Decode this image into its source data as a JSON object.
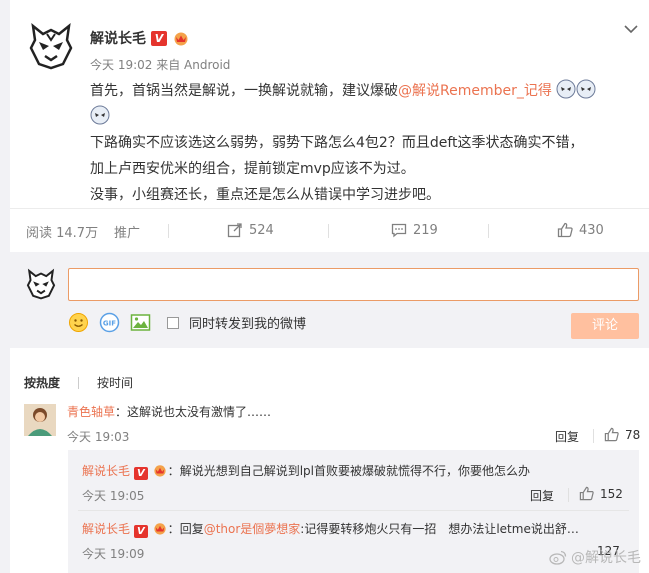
{
  "post": {
    "author": "解说长毛",
    "meta": "今天 19:02 来自 Android",
    "lines": {
      "l1_before": "首先，首锅当然是解说，一换解说就输，建议爆破",
      "l1_mention": "@解说Remember_记得",
      "l2": "下路确实不应该选这么弱势，弱势下路怎么4包2？而且deft这季状态确实不错，",
      "l3": "加上卢西安优米的组合，提前锁定mvp应该不为过。",
      "l4": "没事，小组赛还长，重点还是怎么从错误中学习进步吧。"
    }
  },
  "stats": {
    "reads": "阅读 14.7万",
    "promote": "推广",
    "reposts": "524",
    "comments": "219",
    "likes": "430"
  },
  "composer": {
    "checkbox_label": "同时转发到我的微博",
    "submit_label": "评论"
  },
  "sort": {
    "hot": "按热度",
    "time": "按时间"
  },
  "comments": [
    {
      "name": "青色轴草",
      "sep": "：",
      "text": "这解说也太没有激情了……",
      "time": "今天 19:03",
      "reply": "回复",
      "likes": "78"
    }
  ],
  "replies": [
    {
      "name": "解说长毛",
      "sep": "：",
      "text": "解说光想到自己解说到lpl首败要被爆破就慌得不行，你要他怎么办",
      "time": "今天 19:05",
      "reply": "回复",
      "likes": "152"
    },
    {
      "name": "解说长毛",
      "sep": "：",
      "prefix": "回复",
      "mention": "@thor是個夢想家",
      "text": ":记得要转移炮火只有一招　想办法让letme说出舒…",
      "time": "今天 19:09",
      "likes": "127"
    }
  ],
  "watermark": "@解说长毛",
  "colors": {
    "accent": "#eb7350",
    "submit_disabled": "#ffc09f",
    "panel": "#f2f2f5"
  },
  "icons": [
    "g2-logo-icon",
    "verified-v-icon",
    "vip-crown-icon",
    "chevron-down-icon",
    "repost-icon",
    "comment-icon",
    "like-icon",
    "smile-icon",
    "gif-icon",
    "image-icon",
    "weibo-icon"
  ]
}
